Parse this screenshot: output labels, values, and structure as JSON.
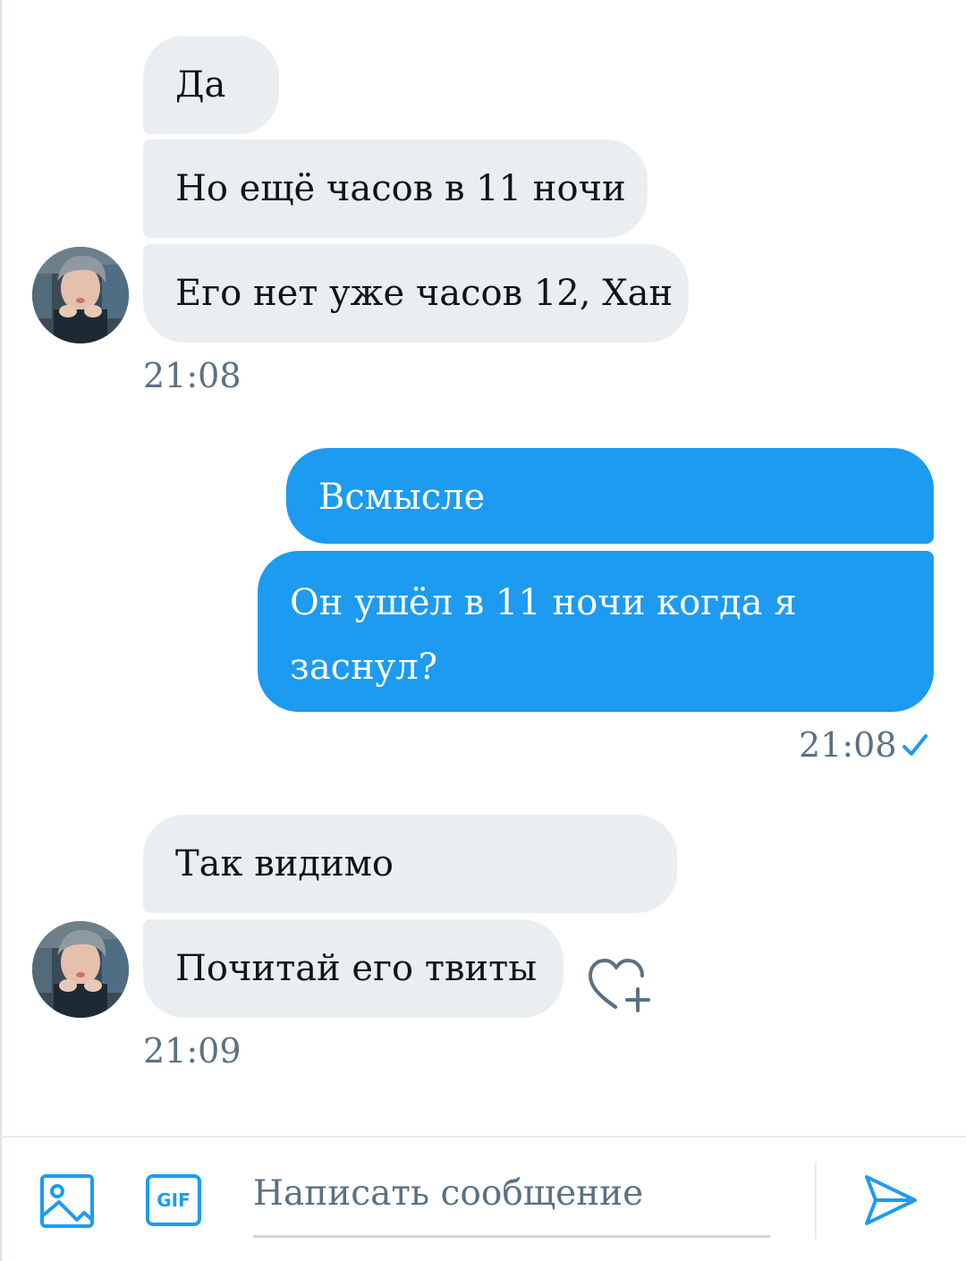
{
  "thread": {
    "group1": {
      "messages": [
        "Да",
        "Но ещё часов в 11 ночи",
        "Его нет уже часов 12, Хан"
      ],
      "time": "21:08"
    },
    "group2": {
      "messages": [
        "Всмысле",
        "Он ушёл в 11 ночи когда я",
        "заснул?"
      ],
      "time": "21:08"
    },
    "group3": {
      "messages": [
        "Так видимо",
        "Почитай его твиты"
      ],
      "time": "21:09"
    }
  },
  "composer": {
    "placeholder": "Написать сообщение",
    "gif_label": "GIF"
  },
  "colors": {
    "accent": "#1d9bf0",
    "incoming_bubble": "#ebeef0",
    "meta_text": "#5b7083"
  },
  "icons": [
    "image-icon",
    "gif-icon",
    "send-icon",
    "read-check-icon",
    "add-reaction-heart-icon"
  ]
}
